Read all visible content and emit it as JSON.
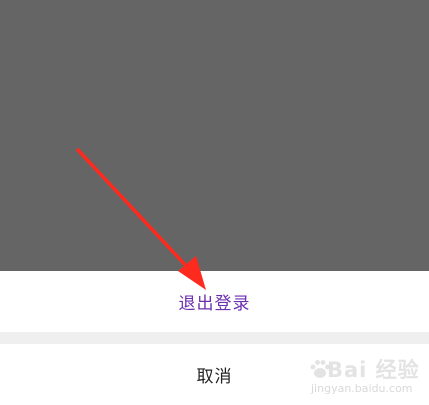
{
  "action_sheet": {
    "logout_label": "退出登录",
    "cancel_label": "取消"
  },
  "watermark": {
    "brand": "Bai 经验",
    "url": "jingyan.baidu.com"
  },
  "colors": {
    "overlay": "#656565",
    "logout_text": "#6b2fb0",
    "cancel_text": "#222222",
    "separator": "#efefef",
    "arrow": "#ff2a1e"
  },
  "icons": [
    "red-arrow-annotation",
    "paw-icon"
  ]
}
